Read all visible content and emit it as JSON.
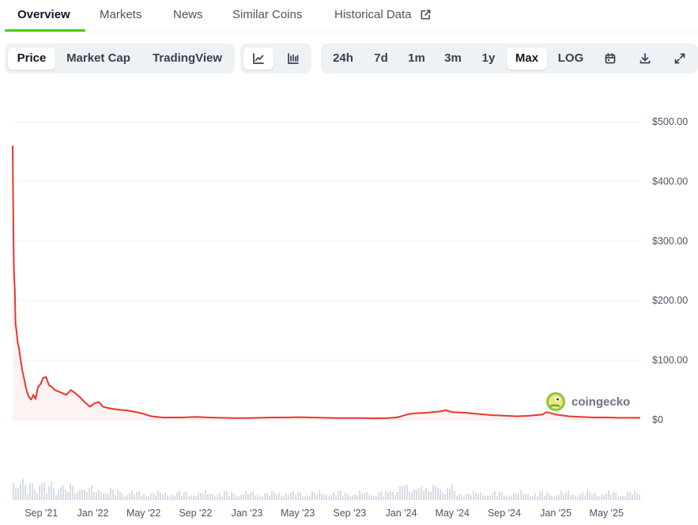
{
  "nav": {
    "tabs": [
      {
        "label": "Overview",
        "active": true
      },
      {
        "label": "Markets"
      },
      {
        "label": "News"
      },
      {
        "label": "Similar Coins"
      },
      {
        "label": "Historical Data",
        "icon": "external-link-icon"
      }
    ]
  },
  "toolbar": {
    "view_tabs": [
      {
        "label": "Price",
        "active": true
      },
      {
        "label": "Market Cap"
      },
      {
        "label": "TradingView"
      }
    ],
    "chart_style_icons": [
      "line-chart-icon",
      "candlestick-chart-icon"
    ],
    "ranges": [
      {
        "label": "24h"
      },
      {
        "label": "7d"
      },
      {
        "label": "1m"
      },
      {
        "label": "3m"
      },
      {
        "label": "1y"
      },
      {
        "label": "Max",
        "active": true
      },
      {
        "label": "LOG"
      }
    ],
    "action_icons": [
      "calendar-icon",
      "download-icon",
      "expand-icon"
    ]
  },
  "watermark": {
    "text": "coingecko",
    "icon": "coingecko-gecko-icon"
  },
  "colors": {
    "line": "#e8372b",
    "accent": "#4bcc00",
    "grid": "#eef0f3",
    "volume": "#d7dde5"
  },
  "chart_data": {
    "type": "line",
    "title": "",
    "xlabel": "",
    "ylabel": "",
    "x_ticks": [
      "Sep '21",
      "Jan '22",
      "May '22",
      "Sep '22",
      "Jan '23",
      "May '23",
      "Sep '23",
      "Jan '24",
      "May '24",
      "Sep '24",
      "Jan '25",
      "May '25"
    ],
    "x_tick_months": [
      "2021-09",
      "2022-01",
      "2022-05",
      "2022-09",
      "2023-01",
      "2023-05",
      "2023-09",
      "2024-01",
      "2024-05",
      "2024-09",
      "2025-01",
      "2025-05"
    ],
    "x_range": [
      "2021-06-25",
      "2025-07-20"
    ],
    "y_ticks": [
      "$0",
      "$100.00",
      "$200.00",
      "$300.00",
      "$400.00",
      "$500.00"
    ],
    "ylim": [
      0,
      500
    ],
    "grid": true,
    "series": [
      {
        "x": [
          "2021-06-25",
          "2021-06-26",
          "2021-06-27",
          "2021-06-28",
          "2021-06-30",
          "2021-07-02",
          "2021-07-04",
          "2021-07-07",
          "2021-07-10",
          "2021-07-14",
          "2021-07-18",
          "2021-07-22",
          "2021-07-26",
          "2021-07-30",
          "2021-08-03",
          "2021-08-08",
          "2021-08-13",
          "2021-08-18",
          "2021-08-24",
          "2021-08-30",
          "2021-09-05",
          "2021-09-12",
          "2021-09-19",
          "2021-09-26",
          "2021-10-03",
          "2021-10-10",
          "2021-10-20",
          "2021-10-30",
          "2021-11-10",
          "2021-11-20",
          "2021-12-01",
          "2021-12-12",
          "2021-12-25",
          "2022-01-05",
          "2022-01-15",
          "2022-01-25",
          "2022-02-05",
          "2022-02-20",
          "2022-03-05",
          "2022-03-20",
          "2022-04-05",
          "2022-04-20",
          "2022-05-01",
          "2022-05-10",
          "2022-05-20",
          "2022-06-01",
          "2022-06-15",
          "2022-07-01",
          "2022-08-01",
          "2022-09-01",
          "2022-10-01",
          "2022-11-01",
          "2022-12-01",
          "2023-01-01",
          "2023-02-01",
          "2023-03-01",
          "2023-04-01",
          "2023-05-01",
          "2023-06-01",
          "2023-07-01",
          "2023-08-01",
          "2023-09-01",
          "2023-10-01",
          "2023-11-01",
          "2023-12-01",
          "2023-12-20",
          "2024-01-01",
          "2024-01-15",
          "2024-02-01",
          "2024-03-01",
          "2024-03-15",
          "2024-04-01",
          "2024-04-15",
          "2024-05-01",
          "2024-06-01",
          "2024-07-01",
          "2024-08-01",
          "2024-09-01",
          "2024-10-01",
          "2024-11-01",
          "2024-12-01",
          "2024-12-10",
          "2025-01-01",
          "2025-02-01",
          "2025-03-01",
          "2025-04-01",
          "2025-05-01",
          "2025-06-01",
          "2025-07-01",
          "2025-07-20"
        ],
        "values": [
          460,
          380,
          300,
          250,
          220,
          160,
          150,
          130,
          120,
          100,
          82,
          70,
          55,
          45,
          38,
          34,
          42,
          35,
          55,
          60,
          70,
          72,
          58,
          55,
          50,
          48,
          45,
          42,
          50,
          45,
          38,
          30,
          22,
          28,
          30,
          22,
          20,
          18,
          17,
          16,
          14,
          12,
          10,
          8,
          6,
          5,
          4,
          4,
          4,
          5,
          4,
          3.5,
          3,
          3,
          3.5,
          4,
          4,
          4.5,
          4,
          3.5,
          3,
          3,
          3,
          2.5,
          3,
          4,
          6,
          9,
          11,
          12,
          13,
          14,
          16,
          13,
          12,
          10,
          8,
          7,
          6,
          7,
          9,
          13,
          9,
          6,
          5,
          4,
          4,
          3.5,
          3.5,
          3.5
        ]
      }
    ]
  }
}
